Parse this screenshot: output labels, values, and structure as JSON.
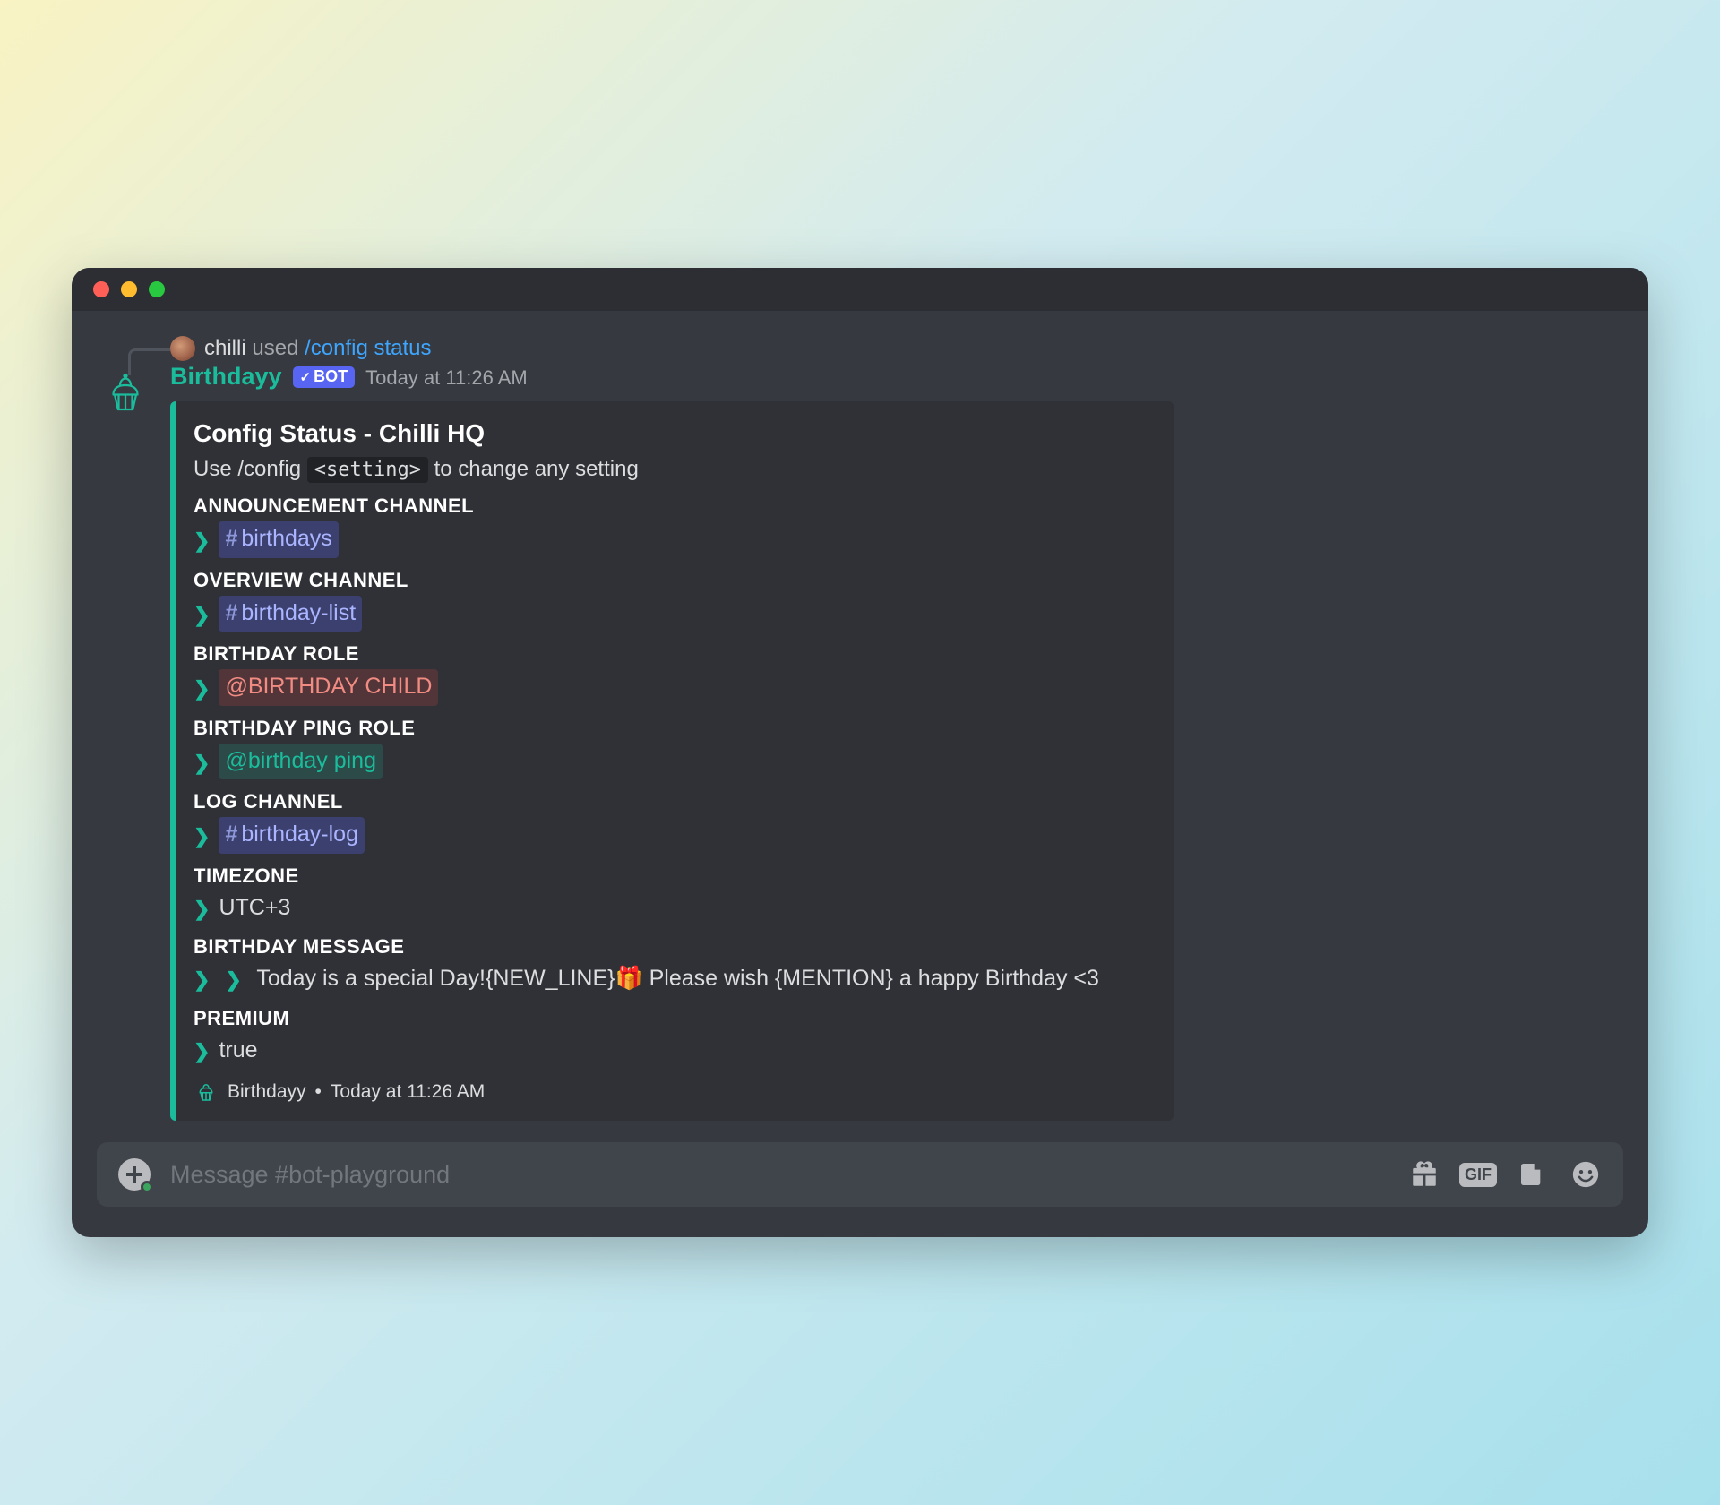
{
  "window": {
    "traffic": [
      "close",
      "minimize",
      "zoom"
    ]
  },
  "reply": {
    "user": "chilli",
    "action": "used",
    "command": "/config status"
  },
  "message": {
    "author": "Birthdayy",
    "bot_tag": "BOT",
    "timestamp": "Today at 11:26 AM"
  },
  "embed": {
    "title": "Config Status - Chilli HQ",
    "desc_prefix": "Use /config ",
    "desc_code": "<setting>",
    "desc_suffix": " to change any setting",
    "fields": {
      "announcement_channel": {
        "name": "ANNOUNCEMENT CHANNEL",
        "channel": "birthdays"
      },
      "overview_channel": {
        "name": "OVERVIEW CHANNEL",
        "channel": "birthday-list"
      },
      "birthday_role": {
        "name": "BIRTHDAY ROLE",
        "role": "@BIRTHDAY CHILD"
      },
      "birthday_ping_role": {
        "name": "BIRTHDAY PING ROLE",
        "role": "@birthday ping"
      },
      "log_channel": {
        "name": "LOG CHANNEL",
        "channel": "birthday-log"
      },
      "timezone": {
        "name": "TIMEZONE",
        "value": "UTC+3"
      },
      "birthday_message": {
        "name": "BIRTHDAY MESSAGE",
        "value": "Today is a special Day!{NEW_LINE}🎁 Please wish {MENTION} a happy Birthday <3"
      },
      "premium": {
        "name": "PREMIUM",
        "value": "true"
      }
    },
    "footer": {
      "name": "Birthdayy",
      "sep": "•",
      "time": "Today at 11:26 AM"
    }
  },
  "composer": {
    "placeholder": "Message #bot-playground",
    "icons": {
      "gift": "gift-icon",
      "gif": "GIF",
      "sticker": "sticker-icon",
      "emoji": "emoji-icon"
    }
  }
}
